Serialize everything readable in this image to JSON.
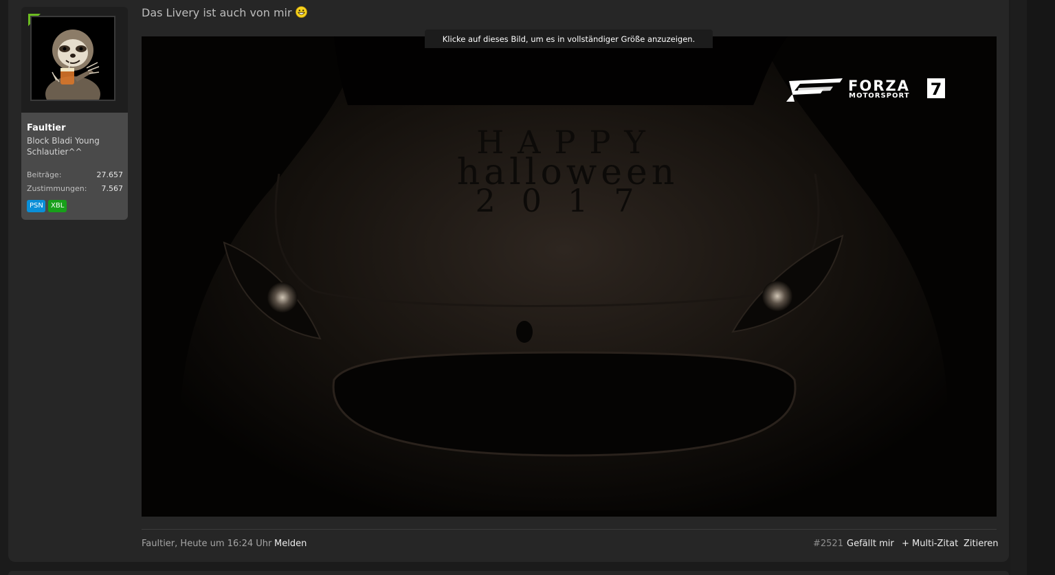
{
  "user": {
    "name": "Faultier",
    "title": "Block Bladi Young Schlautier^^",
    "stats": [
      {
        "label": "Beiträge:",
        "value": "27.657"
      },
      {
        "label": "Zustimmungen:",
        "value": "7.567"
      }
    ],
    "badges": [
      "PSN",
      "XBL"
    ],
    "online_color": "#6cbc21"
  },
  "post": {
    "message": "Das Livery ist auch von mir",
    "emoji": "grinning-face-emoji",
    "image_hint": "Klicke auf dieses Bild, um es in vollständiger Größe anzuzeigen.",
    "image_text": {
      "hood_line1": "HAPPY",
      "hood_line2": "halloween",
      "hood_line3": "2017",
      "logo_brand": "FORZA",
      "logo_sub": "MOTORSPORT",
      "logo_number": "7"
    },
    "footer": {
      "author": "Faultier",
      "time": "Heute um 16:24 Uhr",
      "meta": "Faultier, Heute um 16:24 Uhr",
      "report": "Melden",
      "number": "#2521",
      "like": "Gefällt mir",
      "multiquote": "+ Multi-Zitat",
      "quote": "Zitieren"
    }
  },
  "colors": {
    "background": "#1b1b1b",
    "post_bg": "#262626",
    "user_box": "#4a4a4a",
    "psn": "#0a8fd8",
    "xbl": "#18a01a"
  }
}
